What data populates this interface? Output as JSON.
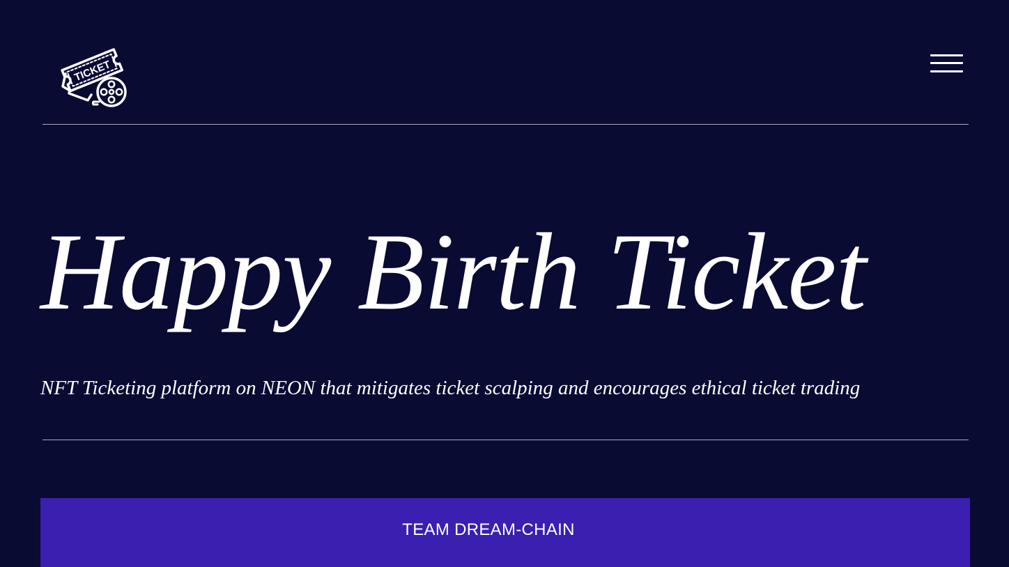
{
  "header": {
    "logo_icon": "ticket-film-reel-icon",
    "logo_text": "TICKET",
    "menu_icon": "hamburger-menu-icon"
  },
  "hero": {
    "title": "Happy Birth Ticket",
    "tagline": "NFT Ticketing platform on NEON that mitigates ticket scalping and encourages ethical ticket trading"
  },
  "team": {
    "label": "TEAM DREAM-CHAIN"
  },
  "colors": {
    "background": "#0a0b33",
    "accent": "#3a1fb0",
    "text": "#ffffff",
    "divider": "#a9abc4"
  }
}
